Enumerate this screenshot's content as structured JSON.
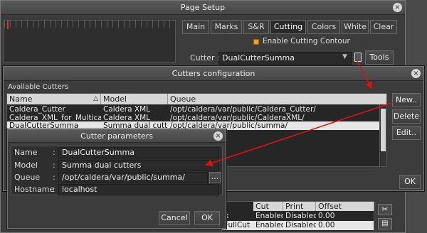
{
  "page_setup": {
    "title": "Page Setup",
    "tabs": [
      {
        "label": "Main"
      },
      {
        "label": "Marks"
      },
      {
        "label": "S&R"
      },
      {
        "label": "Cutting"
      },
      {
        "label": "Colors"
      },
      {
        "label": "White"
      },
      {
        "label": "Clear"
      }
    ],
    "enable_cutting_contour": "Enable Cutting Contour",
    "cutter_label": "Cutter :",
    "cutter_value": "DualCutterSumma",
    "tools_label": "Tools",
    "bottom_table": {
      "headers": [
        "Cut",
        "Print",
        "Offset"
      ],
      "rows": [
        [
          "x",
          "Enabled",
          "Disabled",
          "0.00"
        ],
        [
          "FullCut",
          "Enabled",
          "Disabled",
          "0.00"
        ]
      ]
    }
  },
  "cutters_config": {
    "title": "Cutters configuration",
    "section_label": "Available Cutters",
    "headers": [
      "Name",
      "Model",
      "Queue"
    ],
    "rows": [
      [
        "Caldera_Cutter",
        "Caldera XML",
        "/opt/caldera/var/public/Caldera_Cutter/"
      ],
      [
        "Caldera_XML_for_Multicam",
        "Caldera XML",
        "/opt/caldera/var/public/CalderaXML/"
      ],
      [
        "DualCutterSumma",
        "Summa dual cutters",
        "/opt/caldera/var/public/summa/"
      ],
      [
        "",
        "",
        "blic/summa/"
      ],
      [
        "",
        "",
        "blic/FC7000/"
      ],
      [
        "",
        "",
        "000/"
      ],
      [
        "",
        "",
        "blic/FC9000/"
      ]
    ],
    "selected_row": 2,
    "new_label": "New..",
    "delete_label": "Delete",
    "edit_label": "Edit..",
    "ok_label": "OK"
  },
  "cutter_params": {
    "title": "Cutter parameters",
    "name_label": "Name",
    "name_value": "DualCutterSumma",
    "model_label": "Model",
    "model_value": "Summa dual cutters",
    "queue_label": "Queue",
    "queue_value": "/opt/caldera/var/public/summa/",
    "browse_label": "...",
    "hostname_label": "Hostname",
    "hostname_value": "localhost",
    "colon": ":",
    "cancel_label": "Cancel",
    "ok_label": "OK"
  },
  "colors": {
    "accent_checkbox": "#f0a020",
    "arrow": "#e01010"
  }
}
